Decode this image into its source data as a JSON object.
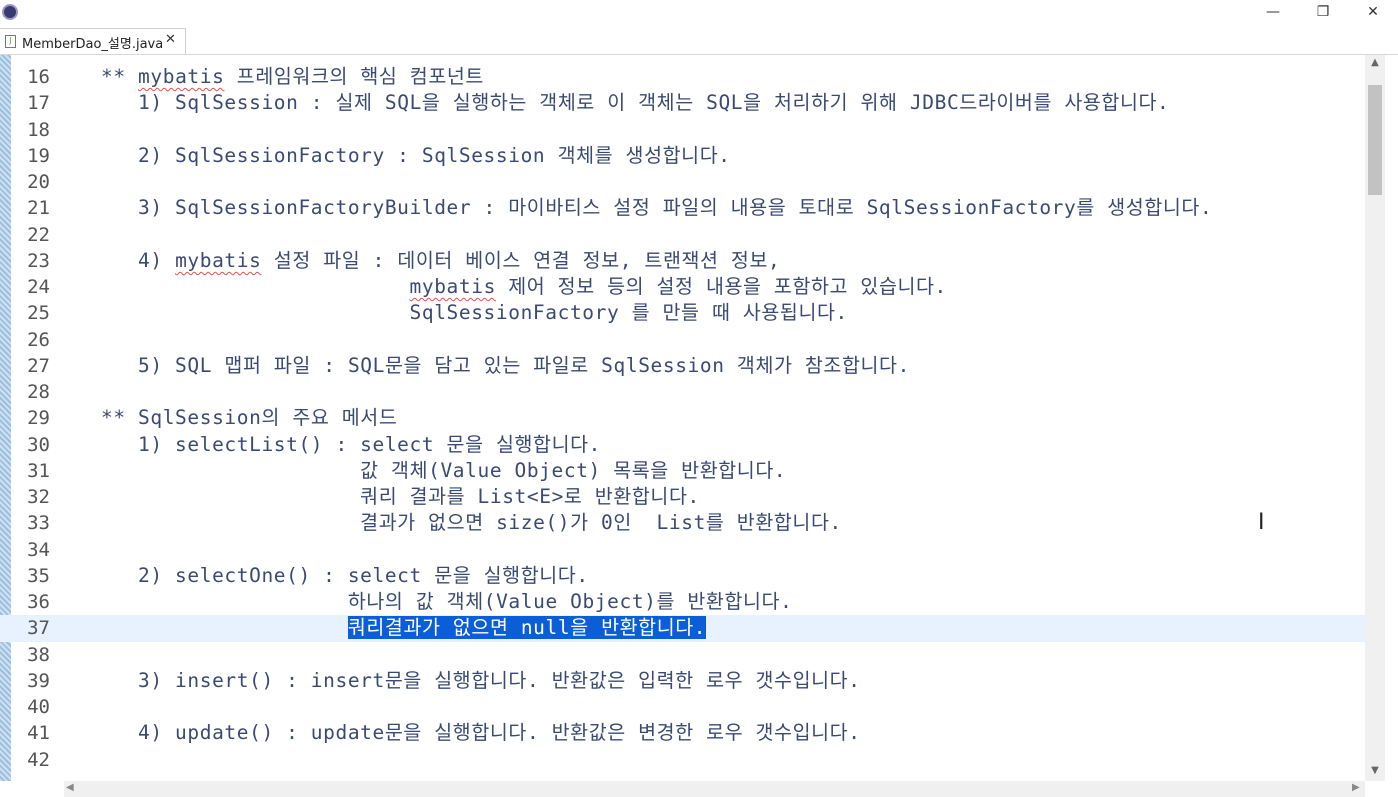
{
  "window": {
    "minimize": "—",
    "restore": "❐",
    "close": "✕"
  },
  "tab": {
    "label": "MemberDao_설명.java",
    "close": "✕",
    "file_icon": "J"
  },
  "view_controls": {
    "minimize": "━",
    "maximize": "☐"
  },
  "editor": {
    "lines": [
      {
        "num": "16",
        "text": "   ** mybatis 프레임워크의 핵심 컴포넌트"
      },
      {
        "num": "17",
        "text": "      1) SqlSession : 실제 SQL을 실행하는 객체로 이 객체는 SQL을 처리하기 위해 JDBC드라이버를 사용합니다."
      },
      {
        "num": "18",
        "text": ""
      },
      {
        "num": "19",
        "text": "      2) SqlSessionFactory : SqlSession 객체를 생성합니다."
      },
      {
        "num": "20",
        "text": ""
      },
      {
        "num": "21",
        "text": "      3) SqlSessionFactoryBuilder : 마이바티스 설정 파일의 내용을 토대로 SqlSessionFactory를 생성합니다."
      },
      {
        "num": "22",
        "text": ""
      },
      {
        "num": "23",
        "text": "      4) mybatis 설정 파일 : 데이터 베이스 연결 정보, 트랜잭션 정보,"
      },
      {
        "num": "24",
        "text": "                            mybatis 제어 정보 등의 설정 내용을 포함하고 있습니다."
      },
      {
        "num": "25",
        "text": "                            SqlSessionFactory 를 만들 때 사용됩니다."
      },
      {
        "num": "26",
        "text": ""
      },
      {
        "num": "27",
        "text": "      5) SQL 맵퍼 파일 : SQL문을 담고 있는 파일로 SqlSession 객체가 참조합니다."
      },
      {
        "num": "28",
        "text": ""
      },
      {
        "num": "29",
        "text": "   ** SqlSession의 주요 메서드"
      },
      {
        "num": "30",
        "text": "      1) selectList() : select 문을 실행합니다."
      },
      {
        "num": "31",
        "text": "                        값 객체(Value Object) 목록을 반환합니다."
      },
      {
        "num": "32",
        "text": "                        쿼리 결과를 List<E>로 반환합니다."
      },
      {
        "num": "33",
        "text": "                        결과가 없으면 size()가 0인  List를 반환합니다."
      },
      {
        "num": "34",
        "text": ""
      },
      {
        "num": "35",
        "text": "      2) selectOne() : select 문을 실행합니다."
      },
      {
        "num": "36",
        "text": "                       하나의 값 객체(Value Object)를 반환합니다."
      },
      {
        "num": "37",
        "text": "                       쿼리결과가 없으면 null을 반환합니다."
      },
      {
        "num": "38",
        "text": ""
      },
      {
        "num": "39",
        "text": "      3) insert() : insert문을 실행합니다. 반환값은 입력한 로우 갯수입니다."
      },
      {
        "num": "40",
        "text": ""
      },
      {
        "num": "41",
        "text": "      4) update() : update문을 실행합니다. 반환값은 변경한 로우 갯수입니다."
      },
      {
        "num": "42",
        "text": ""
      }
    ],
    "current_line": "37",
    "selected_text": "쿼리결과가 없으면 null을 반환합니다.",
    "spell_underlined": [
      "mybatis"
    ]
  },
  "icons": {
    "app": "eclipse-icon",
    "scroll_up": "▲",
    "scroll_down": "▼",
    "scroll_left": "◀",
    "scroll_right": "▶",
    "ibeam": "Ⅰ"
  },
  "colors": {
    "selection": "#0a5fd8",
    "current_line": "#e8f2fe",
    "code_text": "#3b4a72"
  }
}
